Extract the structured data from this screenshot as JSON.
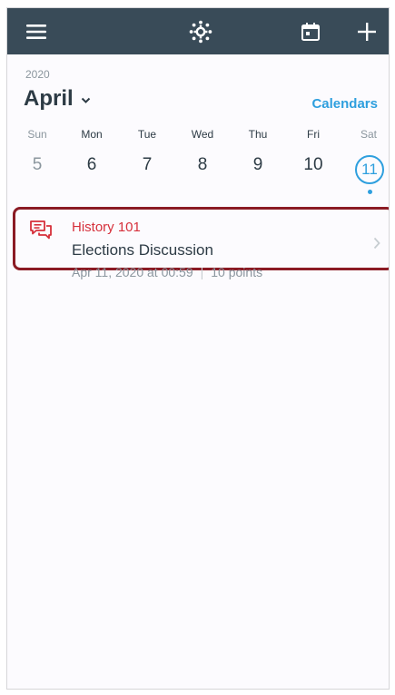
{
  "header": {
    "menu_icon": "hamburger-menu-icon",
    "logo_icon": "canvas-logo-icon",
    "calendar_icon": "calendar-today-icon",
    "add_icon": "plus-icon",
    "background": "#394b58"
  },
  "calendar": {
    "year": "2020",
    "month": "April",
    "calendars_link": "Calendars",
    "accent": "#2e9fde",
    "days": [
      {
        "dow": "Sun",
        "num": "5"
      },
      {
        "dow": "Mon",
        "num": "6"
      },
      {
        "dow": "Tue",
        "num": "7"
      },
      {
        "dow": "Wed",
        "num": "8"
      },
      {
        "dow": "Thu",
        "num": "9"
      },
      {
        "dow": "Fri",
        "num": "10"
      },
      {
        "dow": "Sat",
        "num": "11"
      }
    ],
    "selected_day": "11"
  },
  "event": {
    "icon": "discussion-icon",
    "course": "History 101",
    "title": "Elections Discussion",
    "date": "Apr 11, 2020 at 00:59",
    "points": "10 points",
    "course_color": "#d6303b",
    "highlight_color": "#8b1b24"
  }
}
